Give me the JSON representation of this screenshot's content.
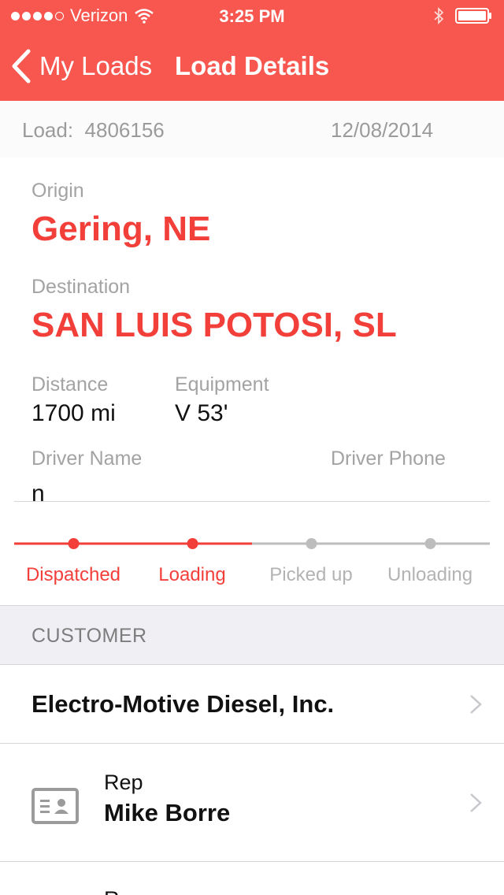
{
  "status_bar": {
    "carrier": "Verizon",
    "time": "3:25 PM",
    "signal_bars_filled": 4,
    "signal_bars_total": 5
  },
  "nav": {
    "back_label": "My Loads",
    "title": "Load Details"
  },
  "load": {
    "label": "Load:",
    "number": "4806156",
    "date": "12/08/2014"
  },
  "origin": {
    "label": "Origin",
    "value": "Gering, NE"
  },
  "destination": {
    "label": "Destination",
    "value": "SAN LUIS POTOSI, SL"
  },
  "distance": {
    "label": "Distance",
    "value": "1700 mi"
  },
  "equipment": {
    "label": "Equipment",
    "value": "V 53'"
  },
  "driver": {
    "name_label": "Driver Name",
    "name_value": "n",
    "phone_label": "Driver Phone"
  },
  "progress": {
    "active_color": "#f23f3a",
    "inactive_color": "#bdbdbd",
    "stages": [
      {
        "label": "Dispatched",
        "active": true
      },
      {
        "label": "Loading",
        "active": true
      },
      {
        "label": "Picked up",
        "active": false
      },
      {
        "label": "Unloading",
        "active": false
      }
    ]
  },
  "customer": {
    "section_title": "CUSTOMER",
    "name": "Electro-Motive Diesel, Inc.",
    "rep_label": "Rep",
    "rep_name": "Mike Borre",
    "next_label": "R"
  },
  "colors": {
    "accent": "#f7574f"
  },
  "icons": [
    "signal-dots-icon",
    "wifi-icon",
    "bluetooth-icon",
    "battery-icon",
    "back-chevron-icon",
    "chevron-right-icon",
    "contact-card-icon"
  ]
}
